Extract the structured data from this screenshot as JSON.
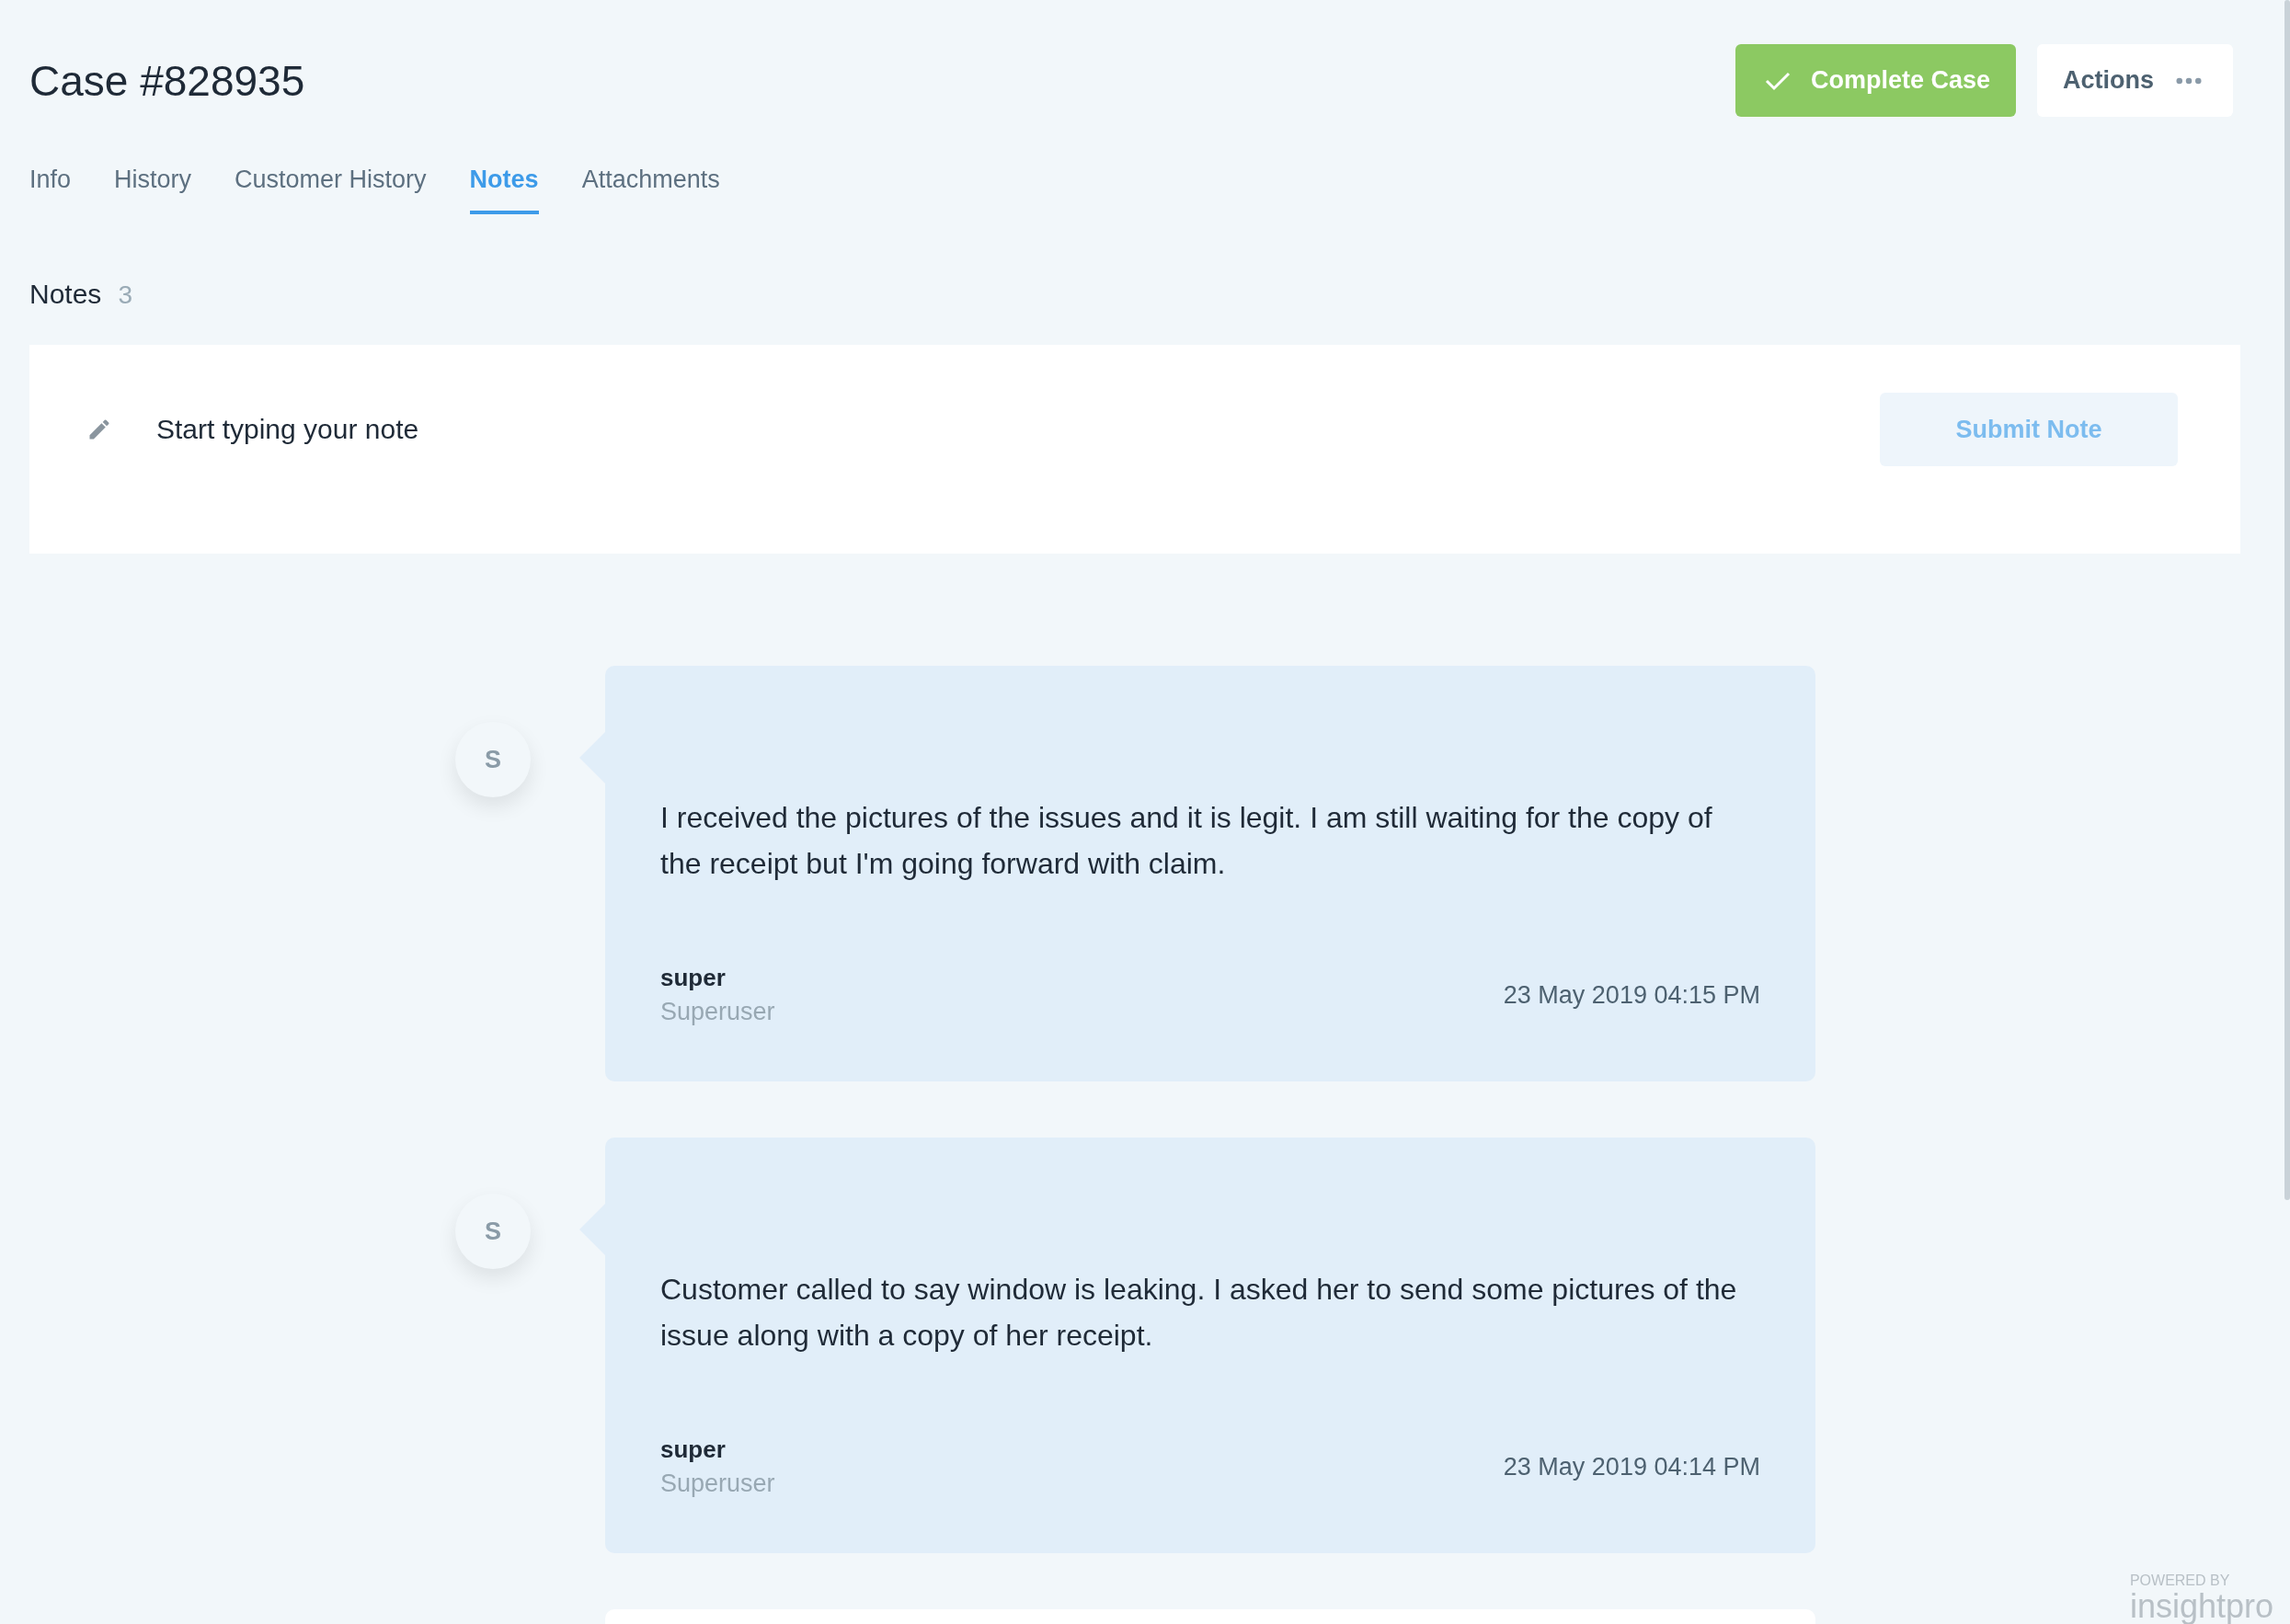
{
  "case_title": "Case #828935",
  "header_actions": {
    "complete": "Complete Case",
    "actions": "Actions"
  },
  "tabs": [
    {
      "label": "Info",
      "selected": false
    },
    {
      "label": "History",
      "selected": false
    },
    {
      "label": "Customer History",
      "selected": false
    },
    {
      "label": "Notes",
      "selected": true
    },
    {
      "label": "Attachments",
      "selected": false
    }
  ],
  "notes_section": {
    "title": "Notes",
    "count": "3"
  },
  "composer": {
    "placeholder": "Start typing your note",
    "submit": "Submit Note"
  },
  "notes": [
    {
      "avatar": "S",
      "text": "I received the pictures of the issues and it is legit. I am still waiting for the copy of the receipt but I'm going forward with claim.",
      "author": "super",
      "role": "Superuser",
      "timestamp": "23 May 2019 04:15 PM"
    },
    {
      "avatar": "S",
      "text": "Customer called to say window is leaking. I asked her to send some pictures of the issue along with a copy of her receipt.",
      "author": "super",
      "role": "Superuser",
      "timestamp": "23 May 2019 04:14 PM"
    }
  ],
  "more_notes_below": true,
  "branding": {
    "caption": "POWERED BY",
    "name": "insightpro"
  }
}
